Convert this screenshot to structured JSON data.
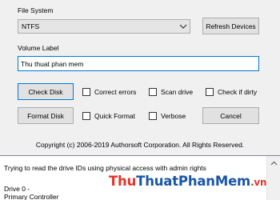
{
  "file_system": {
    "label": "File System",
    "selected": "NTFS"
  },
  "buttons": {
    "refresh": "Refresh Devices",
    "check_disk": "Check Disk",
    "format_disk": "Format Disk",
    "cancel": "Cancel"
  },
  "volume": {
    "label": "Volume Label",
    "value": "Thu thuat phan mem"
  },
  "options": {
    "correct_errors": "Correct errors",
    "scan_drive": "Scan drive",
    "check_if_dirty": "Check if dirty",
    "quick_format": "Quick Format",
    "verbose": "Verbose"
  },
  "copyright": "Copyright (c) 2006-2019 Authorsoft Corporation. All Rights Reserved.",
  "log": {
    "lines": [
      "Trying to read the drive IDs using physical access with admin rights",
      "Drive 0 -",
      "Primary Controller"
    ]
  },
  "watermark": {
    "part1": "Thu",
    "part2": "ThuatPhanMem",
    "part3": ".vn"
  }
}
